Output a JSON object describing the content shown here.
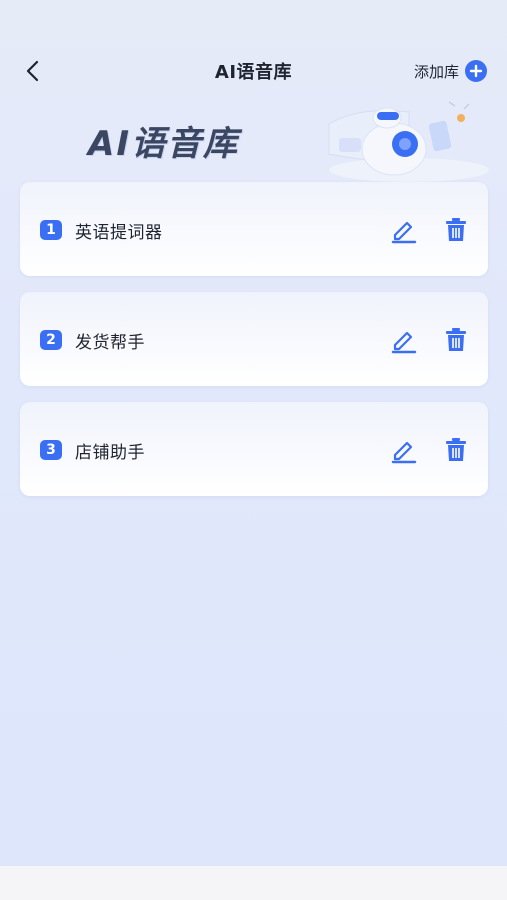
{
  "header": {
    "title": "AI语音库",
    "add_label": "添加库"
  },
  "banner": {
    "title": "AI语音库"
  },
  "libraries": [
    {
      "index": "1",
      "name": "英语提词器"
    },
    {
      "index": "2",
      "name": "发货帮手"
    },
    {
      "index": "3",
      "name": "店铺助手"
    }
  ],
  "icons": {
    "back": "chevron-left-icon",
    "add": "plus-circle-icon",
    "edit": "pencil-icon",
    "delete": "trash-icon"
  },
  "colors": {
    "accent": "#3b6ff3",
    "background": "#e1e8fb",
    "text": "#1f2430"
  }
}
